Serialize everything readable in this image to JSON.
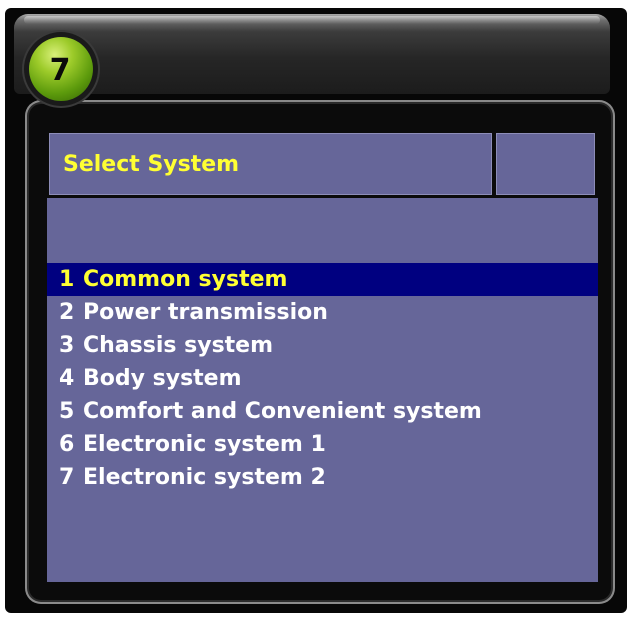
{
  "step_badge": "7",
  "header": {
    "title": "Select System",
    "side_label": ""
  },
  "menu": {
    "selected_index": 0,
    "items": [
      {
        "num": "1",
        "label": "Common system"
      },
      {
        "num": "2",
        "label": "Power transmission"
      },
      {
        "num": "3",
        "label": "Chassis system"
      },
      {
        "num": "4",
        "label": "Body system"
      },
      {
        "num": "5",
        "label": "Comfort and Convenient system"
      },
      {
        "num": "6",
        "label": "Electronic system 1"
      },
      {
        "num": "7",
        "label": "Electronic system 2"
      }
    ]
  },
  "colors": {
    "panel_bg": "#666699",
    "selection_bg": "#000080",
    "title_text": "#ffff33",
    "item_text": "#ffffff",
    "selected_text": "#ffff33",
    "badge_green": "#7cb518"
  }
}
